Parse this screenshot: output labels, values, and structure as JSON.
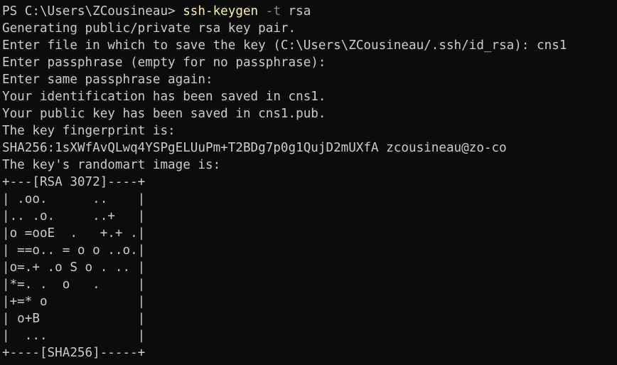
{
  "prompt": {
    "prefix": "PS C:\\Users\\ZCousineau> ",
    "command": "ssh-keygen",
    "space1": " ",
    "flag": "-t",
    "arg": " rsa"
  },
  "output": [
    "Generating public/private rsa key pair.",
    "Enter file in which to save the key (C:\\Users\\ZCousineau/.ssh/id_rsa): cns1",
    "Enter passphrase (empty for no passphrase):",
    "Enter same passphrase again:",
    "Your identification has been saved in cns1.",
    "Your public key has been saved in cns1.pub.",
    "The key fingerprint is:",
    "SHA256:1sXWfAvQLwq4YSPgELUuPm+T2BDg7p0g1QujD2mUXfA zcousineau@zo-co",
    "The key's randomart image is:"
  ],
  "randomart": [
    "+---[RSA 3072]----+",
    "| .oo.      ..    |",
    "|.. .o.     ..+   |",
    "|o =ooE  .   +.+ .|",
    "| ==o.. = o o ..o.|",
    "|o=.+ .o S o . .. |",
    "|*=. .  o   .     |",
    "|+=* o            |",
    "| o+B             |",
    "|  ...            |",
    "+----[SHA256]-----+"
  ]
}
